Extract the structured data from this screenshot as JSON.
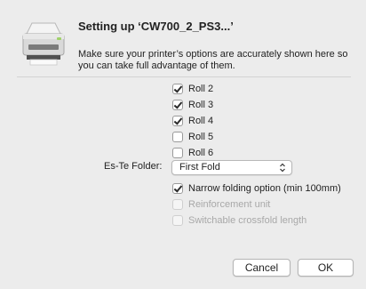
{
  "dialog": {
    "title": "Setting up ‘CW700_2_PS3...’",
    "description": "Make sure your printer’s options are accurately shown here so you can take full advantage of them.",
    "icon": "printer-icon"
  },
  "options": {
    "rolls": [
      {
        "label": "Roll 2",
        "checked": true
      },
      {
        "label": "Roll 3",
        "checked": true
      },
      {
        "label": "Roll 4",
        "checked": true
      },
      {
        "label": "Roll 5",
        "checked": false
      },
      {
        "label": "Roll 6",
        "checked": false
      }
    ],
    "folder": {
      "label": "Es-Te Folder:",
      "selected": "First Fold"
    },
    "narrow_folding": {
      "label": "Narrow folding option (min 100mm)",
      "checked": true,
      "enabled": true
    },
    "reinforcement": {
      "label": "Reinforcement unit",
      "checked": false,
      "enabled": false
    },
    "crossfold": {
      "label": "Switchable crossfold length",
      "checked": false,
      "enabled": false
    }
  },
  "buttons": {
    "cancel": "Cancel",
    "ok": "OK"
  }
}
